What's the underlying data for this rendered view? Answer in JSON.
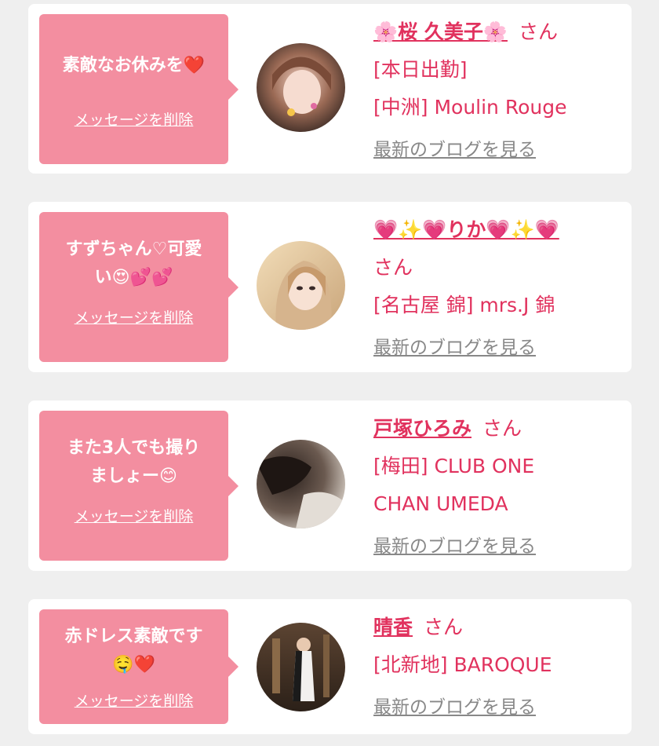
{
  "theme": {
    "bubble_color": "#f38ea0",
    "name_color": "#e1325e",
    "link_color": "#888888",
    "background": "#efefef"
  },
  "common": {
    "delete_label": "メッセージを削除",
    "blog_label": "最新のブログを見る",
    "honorific": "さん"
  },
  "cards": [
    {
      "message_line1": "素敵なお休みを❤️",
      "message_line2": "",
      "name": "🌸桜 久美子🌸",
      "status": "[本日出勤]",
      "shop": "[中洲] Moulin Rouge",
      "shop2": ""
    },
    {
      "message_line1": "すずちゃん♡可愛",
      "message_line2": "い😍💕💕",
      "name": "💗✨💗りか💗✨💗",
      "status": "",
      "shop": "[名古屋 錦] mrs.J 錦",
      "shop2": ""
    },
    {
      "message_line1": "また3人でも撮り",
      "message_line2": "ましょー😊",
      "name": "戸塚ひろみ",
      "status": "",
      "shop": "[梅田] CLUB ONE",
      "shop2": "CHAN UMEDA"
    },
    {
      "message_line1": "赤ドレス素敵です",
      "message_line2": "🤤❤️",
      "name": "晴香",
      "status": "",
      "shop": "[北新地] BAROQUE",
      "shop2": ""
    }
  ]
}
